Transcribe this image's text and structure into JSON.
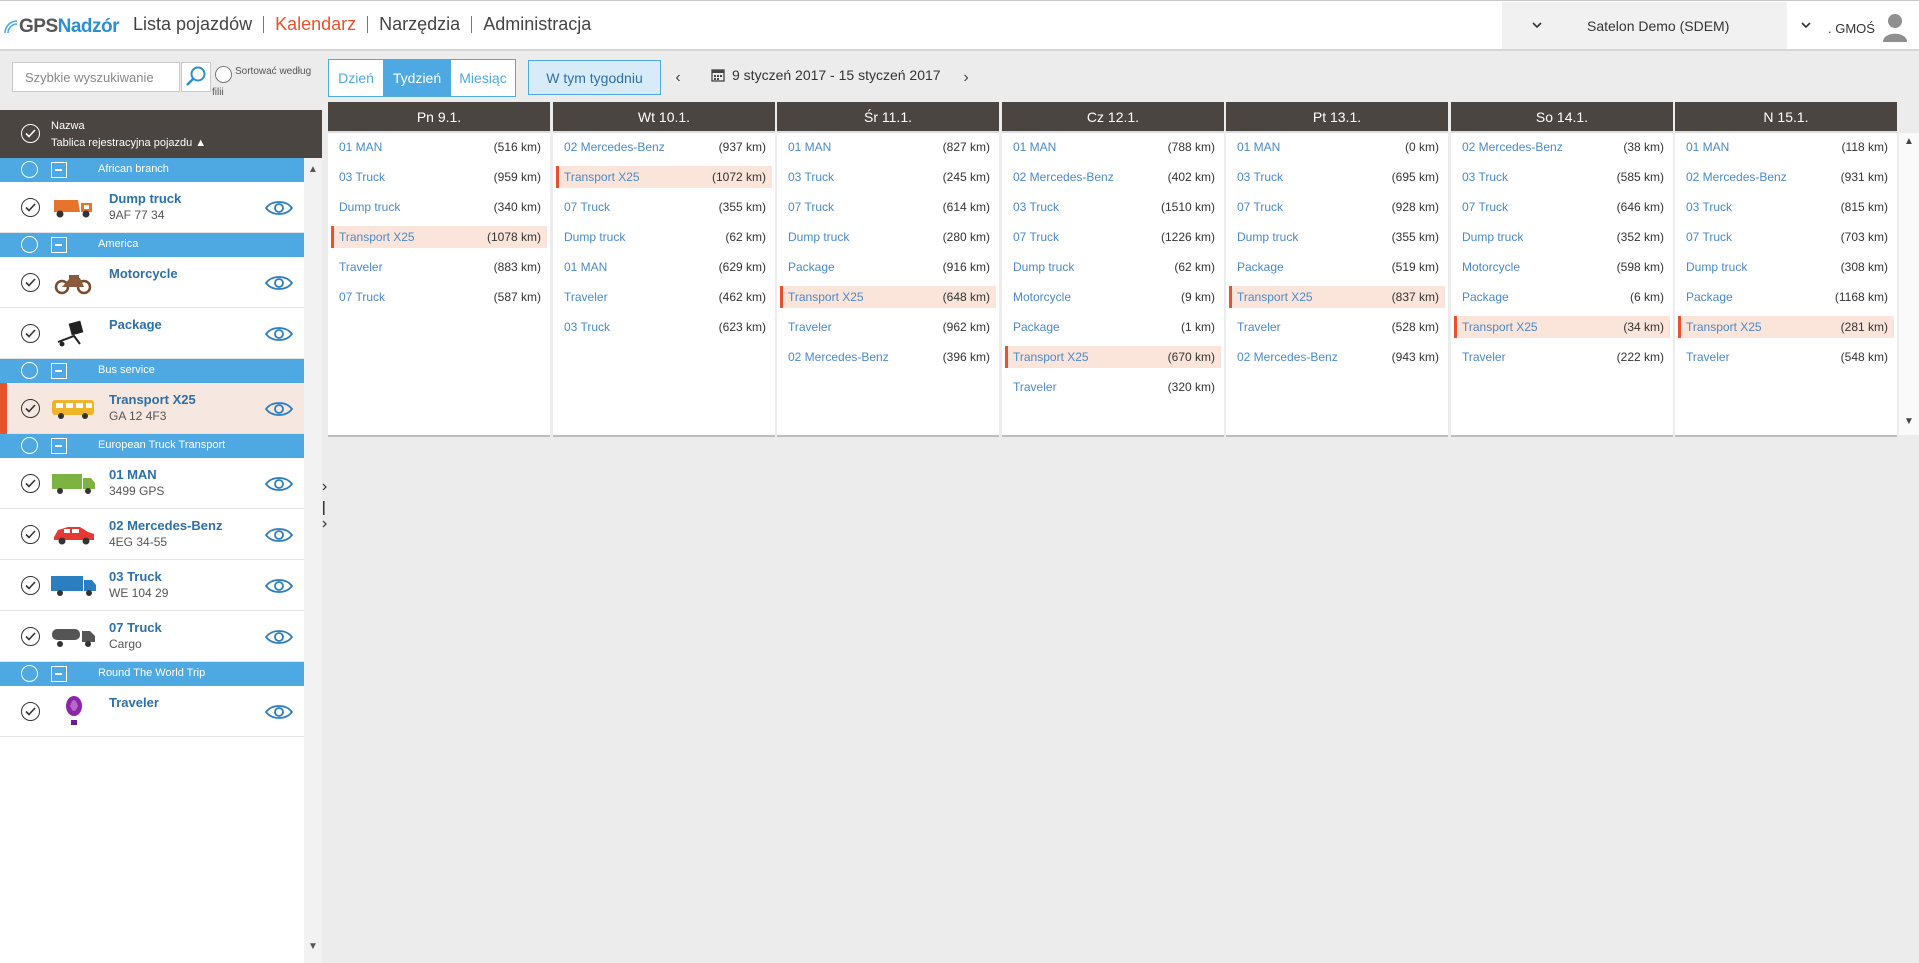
{
  "header": {
    "logo_gps": "GPS",
    "logo_nadzor": "Nadzór",
    "nav": [
      "Lista pojazdów",
      "Kalendarz",
      "Narzędzia",
      "Administracja"
    ],
    "active_nav": "Kalendarz",
    "org": "Satelon Demo (SDEM)",
    "user": ". GMOŚ"
  },
  "colors": {
    "accent_blue": "#4ea8e2",
    "accent_orange": "#e8532b",
    "header_dark": "#4a4541",
    "highlight_bg": "#fbe4da"
  },
  "search": {
    "placeholder": "Szybkie wyszukiwanie",
    "sort_label": "Sortować według",
    "sort_label2": "filii"
  },
  "list_header": {
    "col1": "Nazwa",
    "col2": "Tablica rejestracyjna pojazdu ▲"
  },
  "groups": [
    {
      "label": "African branch"
    },
    {
      "label": "America"
    },
    {
      "label": "Bus service"
    },
    {
      "label": "European Truck Transport"
    },
    {
      "label": "Round The World Trip"
    }
  ],
  "vehicles": [
    {
      "name": "Dump truck",
      "sub": "9AF 77 34",
      "icon": "dump-truck-icon"
    },
    {
      "name": "Motorcycle",
      "sub": "",
      "icon": "motorcycle-icon"
    },
    {
      "name": "Package",
      "sub": "",
      "icon": "package-icon"
    },
    {
      "name": "Transport X25",
      "sub": "GA 12 4F3",
      "icon": "bus-icon"
    },
    {
      "name": "01 MAN",
      "sub": "3499 GPS",
      "icon": "truck-icon"
    },
    {
      "name": "02 Mercedes-Benz",
      "sub": "4EG 34-55",
      "icon": "car-icon"
    },
    {
      "name": "03 Truck",
      "sub": "WE 104 29",
      "icon": "truck-icon"
    },
    {
      "name": "07 Truck",
      "sub": "Cargo",
      "icon": "tanker-icon"
    },
    {
      "name": "Traveler",
      "sub": "",
      "icon": "balloon-icon"
    }
  ],
  "toolbar": {
    "day": "Dzień",
    "week": "Tydzień",
    "month": "Miesiąc",
    "active_view": "Tydzień",
    "this_week": "W tym tygodniu",
    "prev": "‹",
    "next": "›",
    "date_range": "9 styczeń 2017 - 15 styczeń 2017"
  },
  "calendar": [
    {
      "day": "Pn 9.1.",
      "entries": [
        {
          "name": "01 MAN",
          "km": "(516 km)"
        },
        {
          "name": "03 Truck",
          "km": "(959 km)"
        },
        {
          "name": "Dump truck",
          "km": "(340 km)"
        },
        {
          "name": "Transport X25",
          "km": "(1078 km)",
          "hl": true
        },
        {
          "name": "Traveler",
          "km": "(883 km)"
        },
        {
          "name": "07 Truck",
          "km": "(587 km)"
        }
      ]
    },
    {
      "day": "Wt 10.1.",
      "entries": [
        {
          "name": "02 Mercedes-Benz",
          "km": "(937 km)"
        },
        {
          "name": "Transport X25",
          "km": "(1072 km)",
          "hl": true
        },
        {
          "name": "07 Truck",
          "km": "(355 km)"
        },
        {
          "name": "Dump truck",
          "km": "(62 km)"
        },
        {
          "name": "01 MAN",
          "km": "(629 km)"
        },
        {
          "name": "Traveler",
          "km": "(462 km)"
        },
        {
          "name": "03 Truck",
          "km": "(623 km)"
        }
      ]
    },
    {
      "day": "Śr 11.1.",
      "entries": [
        {
          "name": "01 MAN",
          "km": "(827 km)"
        },
        {
          "name": "03 Truck",
          "km": "(245 km)"
        },
        {
          "name": "07 Truck",
          "km": "(614 km)"
        },
        {
          "name": "Dump truck",
          "km": "(280 km)"
        },
        {
          "name": "Package",
          "km": "(916 km)"
        },
        {
          "name": "Transport X25",
          "km": "(648 km)",
          "hl": true
        },
        {
          "name": "Traveler",
          "km": "(962 km)"
        },
        {
          "name": "02 Mercedes-Benz",
          "km": "(396 km)"
        }
      ]
    },
    {
      "day": "Cz 12.1.",
      "entries": [
        {
          "name": "01 MAN",
          "km": "(788 km)"
        },
        {
          "name": "02 Mercedes-Benz",
          "km": "(402 km)"
        },
        {
          "name": "03 Truck",
          "km": "(1510 km)"
        },
        {
          "name": "07 Truck",
          "km": "(1226 km)"
        },
        {
          "name": "Dump truck",
          "km": "(62 km)"
        },
        {
          "name": "Motorcycle",
          "km": "(9 km)"
        },
        {
          "name": "Package",
          "km": "(1 km)"
        },
        {
          "name": "Transport X25",
          "km": "(670 km)",
          "hl": true
        },
        {
          "name": "Traveler",
          "km": "(320 km)"
        }
      ]
    },
    {
      "day": "Pt 13.1.",
      "entries": [
        {
          "name": "01 MAN",
          "km": "(0 km)"
        },
        {
          "name": "03 Truck",
          "km": "(695 km)"
        },
        {
          "name": "07 Truck",
          "km": "(928 km)"
        },
        {
          "name": "Dump truck",
          "km": "(355 km)"
        },
        {
          "name": "Package",
          "km": "(519 km)"
        },
        {
          "name": "Transport X25",
          "km": "(837 km)",
          "hl": true
        },
        {
          "name": "Traveler",
          "km": "(528 km)"
        },
        {
          "name": "02 Mercedes-Benz",
          "km": "(943 km)"
        }
      ]
    },
    {
      "day": "So 14.1.",
      "entries": [
        {
          "name": "02 Mercedes-Benz",
          "km": "(38 km)"
        },
        {
          "name": "03 Truck",
          "km": "(585 km)"
        },
        {
          "name": "07 Truck",
          "km": "(646 km)"
        },
        {
          "name": "Dump truck",
          "km": "(352 km)"
        },
        {
          "name": "Motorcycle",
          "km": "(598 km)"
        },
        {
          "name": "Package",
          "km": "(6 km)"
        },
        {
          "name": "Transport X25",
          "km": "(34 km)",
          "hl": true
        },
        {
          "name": "Traveler",
          "km": "(222 km)"
        }
      ]
    },
    {
      "day": "N 15.1.",
      "entries": [
        {
          "name": "01 MAN",
          "km": "(118 km)"
        },
        {
          "name": "02 Mercedes-Benz",
          "km": "(931 km)"
        },
        {
          "name": "03 Truck",
          "km": "(815 km)"
        },
        {
          "name": "07 Truck",
          "km": "(703 km)"
        },
        {
          "name": "Dump truck",
          "km": "(308 km)"
        },
        {
          "name": "Package",
          "km": "(1168 km)"
        },
        {
          "name": "Transport X25",
          "km": "(281 km)",
          "hl": true
        },
        {
          "name": "Traveler",
          "km": "(548 km)"
        }
      ]
    }
  ]
}
